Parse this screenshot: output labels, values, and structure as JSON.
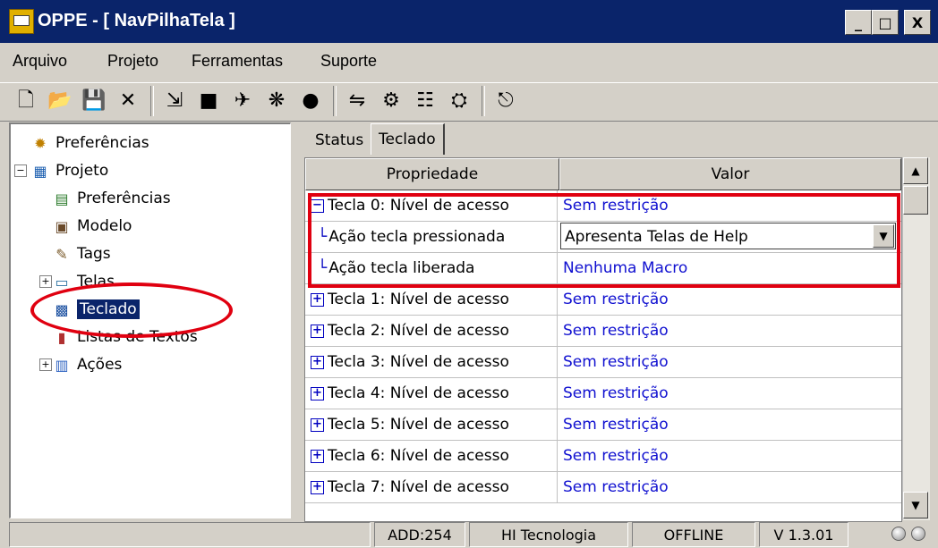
{
  "window": {
    "title": "OPPE - [ NavPilhaTela ]",
    "minimize": "_",
    "maximize": "□",
    "close": "X"
  },
  "menu": [
    "Arquivo",
    "Projeto",
    "Ferramentas",
    "Suporte"
  ],
  "toolbar": {
    "groups": [
      [
        {
          "icon": "new-file-icon",
          "glyph": "🗋"
        },
        {
          "icon": "open-folder-icon",
          "glyph": "📂"
        },
        {
          "icon": "save-icon",
          "glyph": "💾"
        },
        {
          "icon": "delete-icon",
          "glyph": "✕"
        }
      ],
      [
        {
          "icon": "import-icon",
          "glyph": "⇲"
        },
        {
          "icon": "compile-icon",
          "glyph": "■"
        },
        {
          "icon": "search-icon",
          "glyph": "✈"
        },
        {
          "icon": "tree-icon",
          "glyph": "❋"
        },
        {
          "icon": "record-icon",
          "glyph": "●"
        }
      ],
      [
        {
          "icon": "connect-icon",
          "glyph": "⇋"
        },
        {
          "icon": "download-icon",
          "glyph": "⚙"
        },
        {
          "icon": "device-icon",
          "glyph": "☷"
        },
        {
          "icon": "upload-icon",
          "glyph": "⛭"
        }
      ],
      [
        {
          "icon": "exit-icon",
          "glyph": "⎋"
        }
      ]
    ]
  },
  "tree": {
    "items": [
      {
        "label": "Preferências",
        "icon": "preferences-icon",
        "glyph": "✹",
        "indent": 0,
        "expander": ""
      },
      {
        "label": "Projeto",
        "icon": "project-icon",
        "glyph": "▦",
        "indent": 0,
        "expander": "−"
      },
      {
        "label": "Preferências",
        "icon": "project-preferences-icon",
        "glyph": "▤",
        "indent": 1,
        "expander": ""
      },
      {
        "label": "Modelo",
        "icon": "model-icon",
        "glyph": "▣",
        "indent": 1,
        "expander": ""
      },
      {
        "label": "Tags",
        "icon": "tags-icon",
        "glyph": "✎",
        "indent": 1,
        "expander": ""
      },
      {
        "label": "Telas",
        "icon": "screens-icon",
        "glyph": "▭",
        "indent": 1,
        "expander": "+"
      },
      {
        "label": "Teclado",
        "icon": "keyboard-icon",
        "glyph": "▩",
        "indent": 1,
        "expander": "",
        "selected": true
      },
      {
        "label": "Listas de Textos",
        "icon": "text-lists-icon",
        "glyph": "▮",
        "indent": 1,
        "expander": ""
      },
      {
        "label": "Ações",
        "icon": "actions-icon",
        "glyph": "▥",
        "indent": 1,
        "expander": "+"
      }
    ]
  },
  "tabs": [
    {
      "label": "Status"
    },
    {
      "label": "Teclado",
      "active": true
    }
  ],
  "grid": {
    "headers": {
      "property": "Propriedade",
      "value": "Valor"
    },
    "rows": [
      {
        "prop": "Tecla 0: Nível de acesso",
        "value": "Sem restrição",
        "kind": "parent",
        "exp": "−"
      },
      {
        "prop": "Ação tecla pressionada",
        "value": "Apresenta Telas de Help",
        "kind": "child-combo"
      },
      {
        "prop": "Ação tecla liberada",
        "value": "Nenhuma Macro",
        "kind": "child"
      },
      {
        "prop": "Tecla 1: Nível de acesso",
        "value": "Sem restrição",
        "kind": "parent",
        "exp": "+"
      },
      {
        "prop": "Tecla 2: Nível de acesso",
        "value": "Sem restrição",
        "kind": "parent",
        "exp": "+"
      },
      {
        "prop": "Tecla 3: Nível de acesso",
        "value": "Sem restrição",
        "kind": "parent",
        "exp": "+"
      },
      {
        "prop": "Tecla 4: Nível de acesso",
        "value": "Sem restrição",
        "kind": "parent",
        "exp": "+"
      },
      {
        "prop": "Tecla 5: Nível de acesso",
        "value": "Sem restrição",
        "kind": "parent",
        "exp": "+"
      },
      {
        "prop": "Tecla 6: Nível de acesso",
        "value": "Sem restrição",
        "kind": "parent",
        "exp": "+"
      },
      {
        "prop": "Tecla 7: Nível de acesso",
        "value": "Sem restrição",
        "kind": "parent",
        "exp": "+"
      }
    ]
  },
  "status": {
    "address": "ADD:254",
    "company": "HI Tecnologia",
    "connection": "OFFLINE",
    "version": "V 1.3.01"
  },
  "colors": {
    "accent_red": "#e00010",
    "link_blue": "#1010d0",
    "title_bar": "#0a246a",
    "selection": "#0a246a"
  }
}
